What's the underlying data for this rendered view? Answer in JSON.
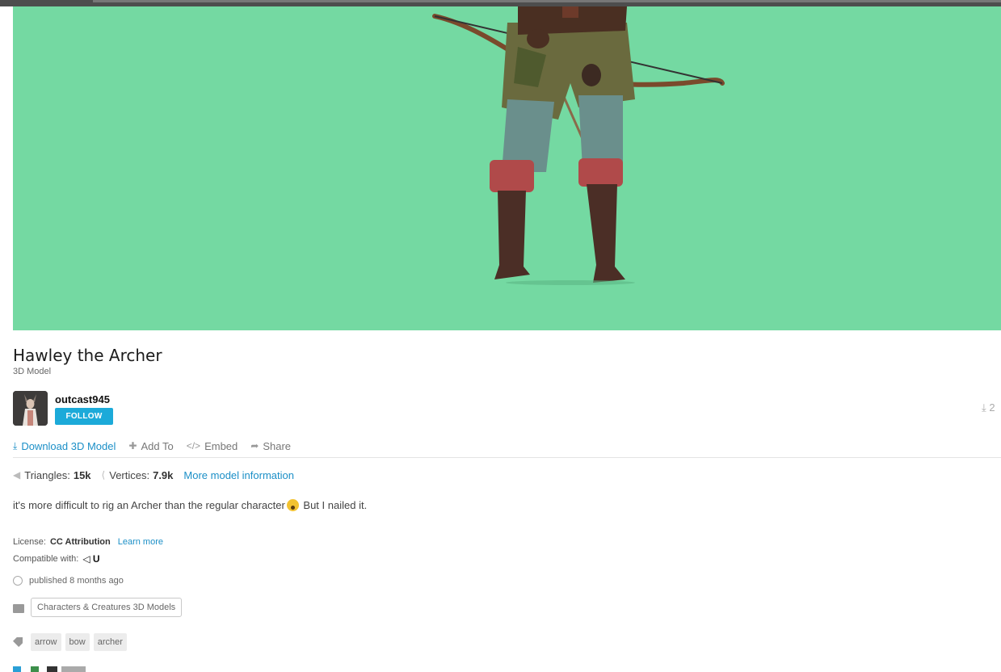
{
  "model": {
    "title": "Hawley the Archer",
    "type_label": "3D Model"
  },
  "author": {
    "name": "outcast945",
    "follow_label": "FOLLOW"
  },
  "download_count": "2",
  "actions": {
    "download": "Download 3D Model",
    "add_to": "Add To",
    "embed": "Embed",
    "share": "Share"
  },
  "stats": {
    "triangles_label": "Triangles:",
    "triangles_value": "15k",
    "vertices_label": "Vertices:",
    "vertices_value": "7.9k",
    "more_info": "More model information"
  },
  "description": {
    "text_before": "it's more difficult to rig an Archer than the regular character",
    "text_after": " But I nailed it."
  },
  "license": {
    "label": "License:",
    "value": "CC Attribution",
    "learn_more": "Learn more"
  },
  "compatibility": {
    "label": "Compatible with:",
    "engines": "◁ U"
  },
  "published": "published 8 months ago",
  "category": "Characters & Creatures 3D Models",
  "tags": [
    "arrow",
    "bow",
    "archer"
  ],
  "colors": {
    "viewer_bg": "#74d9a2",
    "accent": "#1b8fc7",
    "follow_button": "#1caad9"
  }
}
